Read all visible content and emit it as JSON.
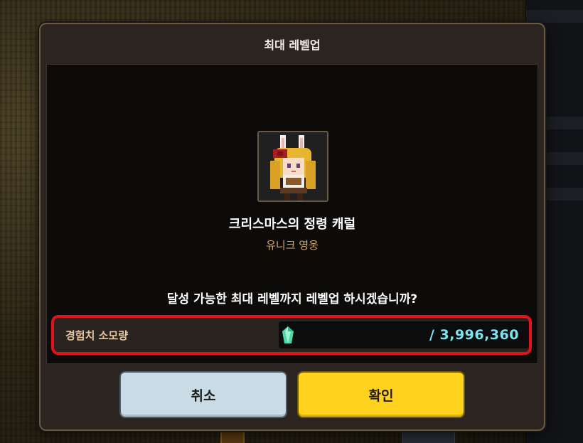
{
  "dialog": {
    "title": "최대 레벨업",
    "hero": {
      "name": "크리스마스의 정령 캐럴",
      "rarity": "유니크 영웅"
    },
    "question": "달성 가능한 최대 레벨까지 레벨업 하시겠습니까?",
    "cost": {
      "label": "경험치 소모량",
      "icon": "crystal-icon",
      "value": "/ 3,996,360"
    },
    "buttons": {
      "cancel_label": "취소",
      "confirm_label": "확인"
    }
  },
  "colors": {
    "highlight_border": "#e0121b",
    "confirm_button": "#ffd21f",
    "cancel_button": "#c9dce6",
    "cost_value": "#7be4f0",
    "rarity_text": "#d4a86a"
  }
}
